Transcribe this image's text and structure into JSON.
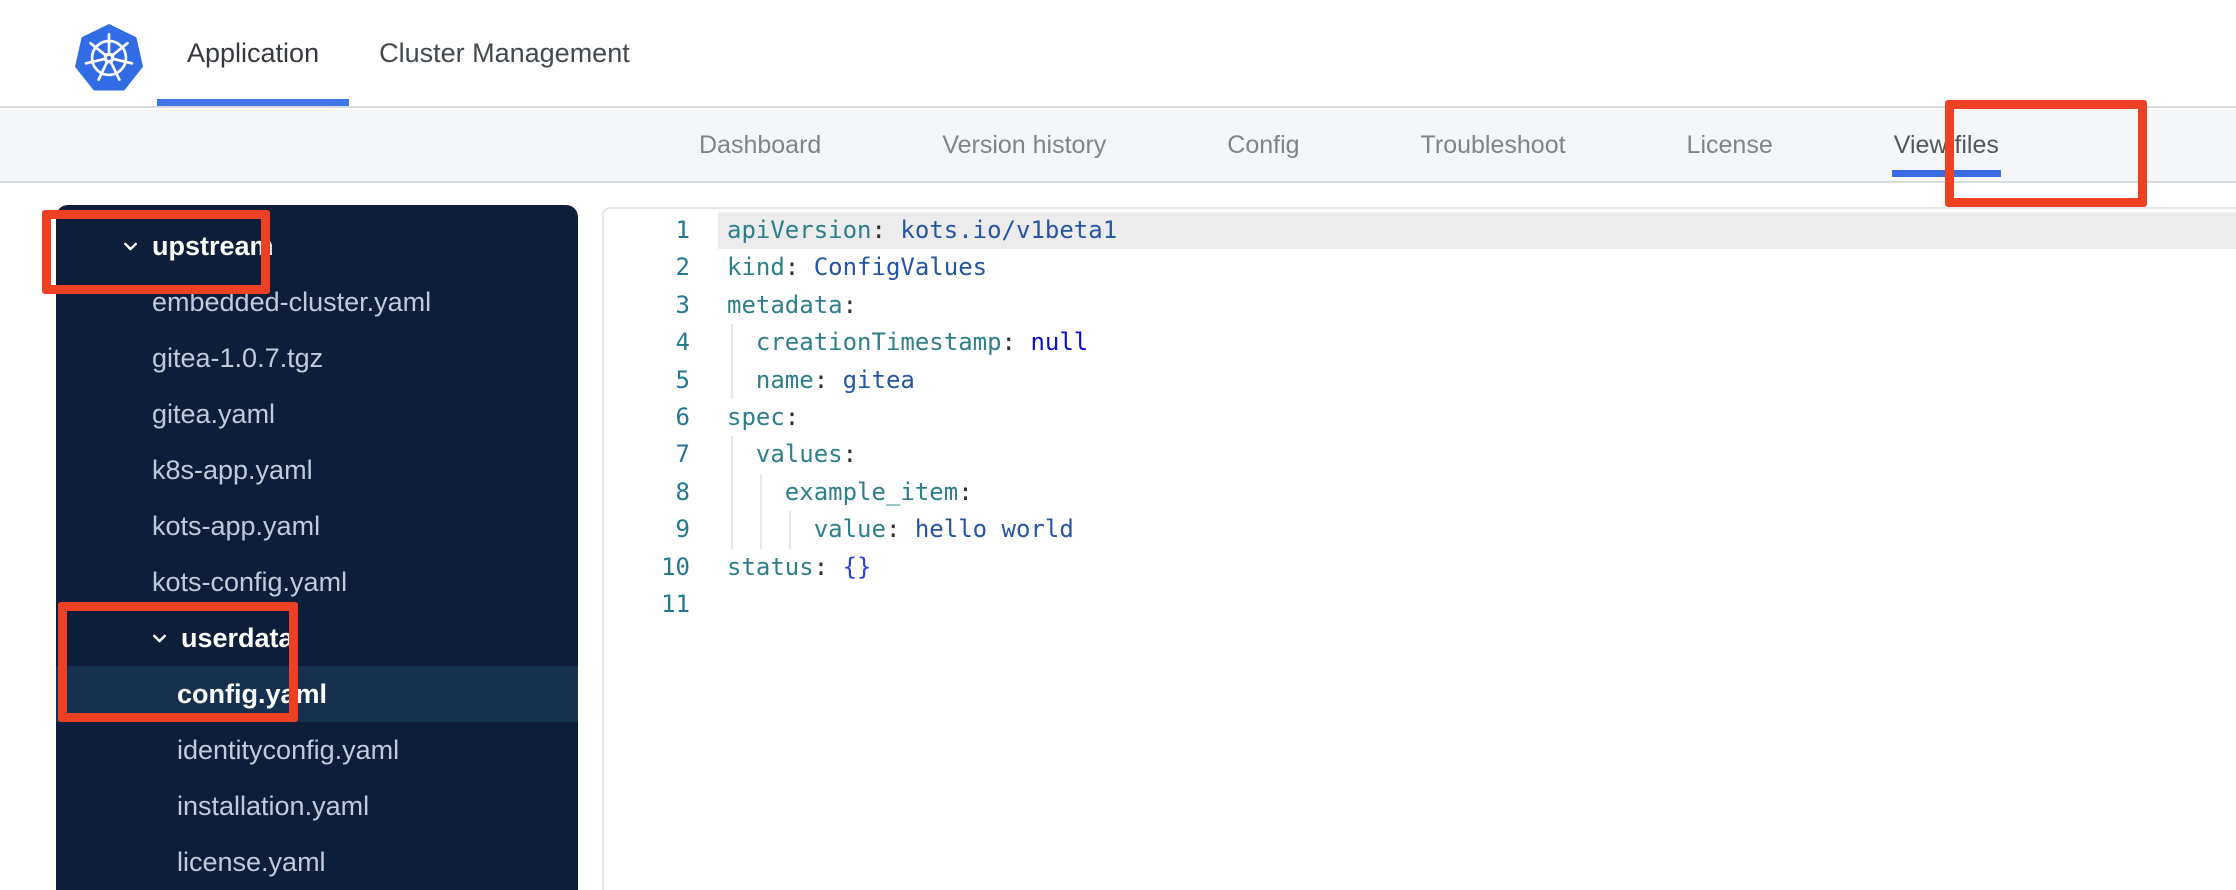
{
  "header": {
    "logo": "kubernetes-logo",
    "tabs": [
      {
        "label": "Application",
        "active": true
      },
      {
        "label": "Cluster Management",
        "active": false
      }
    ]
  },
  "subnav": {
    "tabs": [
      {
        "label": "Dashboard",
        "active": false
      },
      {
        "label": "Version history",
        "active": false
      },
      {
        "label": "Config",
        "active": false
      },
      {
        "label": "Troubleshoot",
        "active": false
      },
      {
        "label": "License",
        "active": false
      },
      {
        "label": "View files",
        "active": true
      }
    ]
  },
  "file_tree": {
    "items": [
      {
        "type": "folder",
        "label": "upstream",
        "depth": 0,
        "expanded": true,
        "annotated": true
      },
      {
        "type": "file",
        "label": "embedded-cluster.yaml",
        "depth": 1
      },
      {
        "type": "file",
        "label": "gitea-1.0.7.tgz",
        "depth": 1
      },
      {
        "type": "file",
        "label": "gitea.yaml",
        "depth": 1
      },
      {
        "type": "file",
        "label": "k8s-app.yaml",
        "depth": 1
      },
      {
        "type": "file",
        "label": "kots-app.yaml",
        "depth": 1
      },
      {
        "type": "file",
        "label": "kots-config.yaml",
        "depth": 1
      },
      {
        "type": "folder",
        "label": "userdata",
        "depth": 1,
        "expanded": true,
        "annotated": true
      },
      {
        "type": "file",
        "label": "config.yaml",
        "depth": 2,
        "selected": true,
        "annotated": true
      },
      {
        "type": "file",
        "label": "identityconfig.yaml",
        "depth": 2
      },
      {
        "type": "file",
        "label": "installation.yaml",
        "depth": 2
      },
      {
        "type": "file",
        "label": "license.yaml",
        "depth": 2
      }
    ]
  },
  "editor": {
    "lines": [
      {
        "num": 1,
        "indent": 0,
        "key": "apiVersion",
        "value": "kots.io/v1beta1",
        "value_type": "string",
        "highlight": true
      },
      {
        "num": 2,
        "indent": 0,
        "key": "kind",
        "value": "ConfigValues",
        "value_type": "string"
      },
      {
        "num": 3,
        "indent": 0,
        "key": "metadata"
      },
      {
        "num": 4,
        "indent": 2,
        "key": "creationTimestamp",
        "value": "null",
        "value_type": "keyword"
      },
      {
        "num": 5,
        "indent": 2,
        "key": "name",
        "value": "gitea",
        "value_type": "string"
      },
      {
        "num": 6,
        "indent": 0,
        "key": "spec"
      },
      {
        "num": 7,
        "indent": 2,
        "key": "values"
      },
      {
        "num": 8,
        "indent": 4,
        "key": "example_item"
      },
      {
        "num": 9,
        "indent": 6,
        "key": "value",
        "value": "hello world",
        "value_type": "string"
      },
      {
        "num": 10,
        "indent": 0,
        "key": "status",
        "value": "{}",
        "value_type": "bracket"
      },
      {
        "num": 11,
        "indent": 0
      }
    ]
  },
  "annotations": [
    {
      "id": "annot-view-files",
      "target": "View files tab"
    },
    {
      "id": "annot-upstream",
      "target": "upstream folder"
    },
    {
      "id": "annot-userdata-config",
      "target": "userdata folder and config.yaml file"
    }
  ],
  "colors": {
    "accent_blue": "#3b6ce5",
    "header_underline_blue": "#4377e6",
    "annotation_red": "#ee4123",
    "sidebar_bg": "#0e1e3a",
    "sidebar_selected_bg": "#16304f",
    "yaml_key": "#2e7f8c",
    "yaml_string": "#2456a5",
    "yaml_keyword": "#0b0bd8",
    "yaml_bracket": "#2940e0",
    "line_number": "#237893",
    "kubernetes_blue": "#326ce5"
  }
}
